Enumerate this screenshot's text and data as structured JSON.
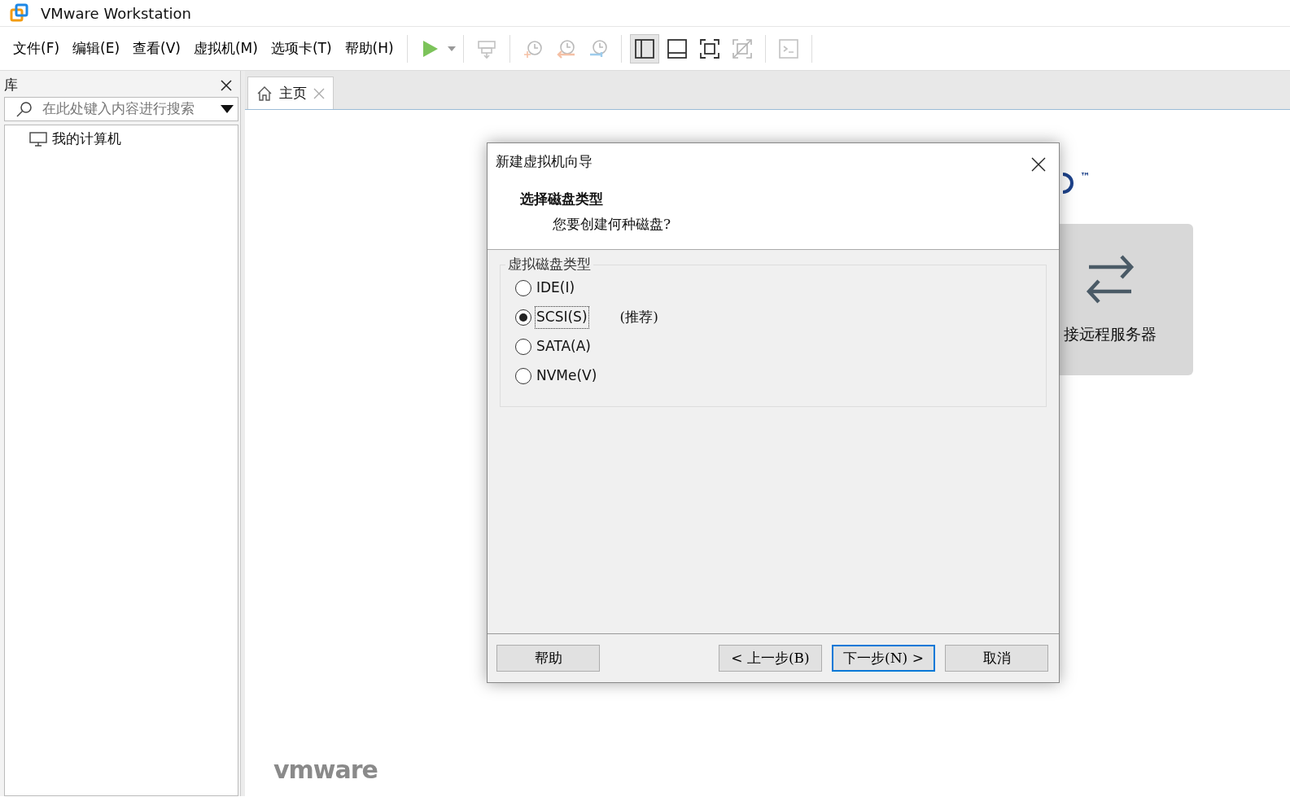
{
  "window": {
    "title": "VMware Workstation"
  },
  "menu": [
    "文件(F)",
    "编辑(E)",
    "查看(V)",
    "虚拟机(M)",
    "选项卡(T)",
    "帮助(H)"
  ],
  "toolbar": {
    "power": {
      "disabled": false
    },
    "tools": [
      {
        "disabled": true
      },
      {
        "disabled": true
      },
      {
        "disabled": true
      },
      {
        "disabled": true
      }
    ],
    "views": [
      {
        "selected": true,
        "disabled": false
      },
      {
        "selected": false,
        "disabled": false
      },
      {
        "selected": false,
        "disabled": false
      },
      {
        "selected": false,
        "disabled": true
      }
    ],
    "console": {
      "disabled": true
    }
  },
  "library": {
    "title": "库",
    "search": {
      "placeholder": "在此处键入内容进行搜索"
    },
    "items": [
      {
        "label": "我的计算机",
        "selected": false
      }
    ]
  },
  "tabs": [
    {
      "label": "主页",
      "selected": true
    }
  ],
  "home": {
    "trademark": "™",
    "card": {
      "label": "接远程服务器"
    },
    "brand": "vmware"
  },
  "dialog": {
    "title": "新建虚拟机向导",
    "heading": "选择磁盘类型",
    "subheading": "您要创建何种磁盘?",
    "group": "虚拟磁盘类型",
    "options": [
      {
        "label": "IDE(I)",
        "selected": false,
        "focused": false
      },
      {
        "label": "SCSI(S)",
        "selected": true,
        "focused": true,
        "note": "(推荐)"
      },
      {
        "label": "SATA(A)",
        "selected": false,
        "focused": false
      },
      {
        "label": "NVMe(V)",
        "selected": false,
        "focused": false
      }
    ],
    "buttons": [
      {
        "label": "帮助",
        "default": false
      },
      {
        "label": "< 上一步(B)",
        "default": false
      },
      {
        "label": "下一步(N) >",
        "default": true
      },
      {
        "label": "取消",
        "default": false
      }
    ]
  }
}
